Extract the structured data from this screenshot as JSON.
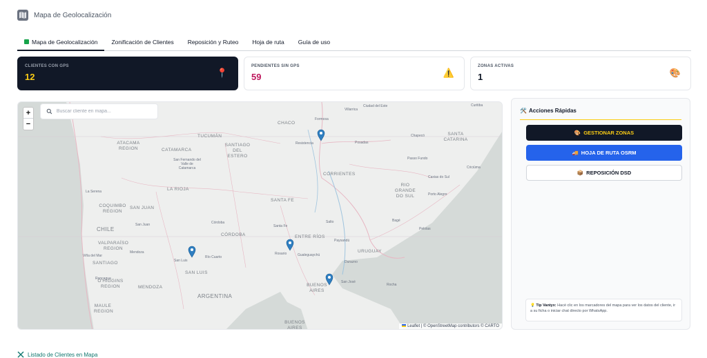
{
  "header": {
    "title": "Mapa de Geolocalización",
    "logo_icon": "map-icon"
  },
  "tabs": [
    {
      "label": "Mapa de Geolocalización",
      "active": true
    },
    {
      "label": "Zonificación de Clientes",
      "active": false
    },
    {
      "label": "Reposición y Ruteo",
      "active": false
    },
    {
      "label": "Hoja de ruta",
      "active": false
    },
    {
      "label": "Guía de uso",
      "active": false
    }
  ],
  "stats": [
    {
      "label": "CLIENTES CON GPS",
      "value": "12",
      "icon": "📍"
    },
    {
      "label": "PENDIENTES SIN GPS",
      "value": "59",
      "icon": "⚠️"
    },
    {
      "label": "ZONAS ACTIVAS",
      "value": "1",
      "icon": "🎨"
    }
  ],
  "map": {
    "zoom_in": "+",
    "zoom_out": "−",
    "search_placeholder": "Buscar cliente en mapa...",
    "attribution": "Leaflet | © OpenStreetMap contributors © CARTO",
    "places": {
      "chaco": "CHACO",
      "tucuman": "TUCUMÁN",
      "atacama": "ATACAMA REGION",
      "catamarca": "CATAMARCA",
      "santiago": "SANTIAGO DEL ESTERO",
      "corrientes": "CORRIENTES",
      "santa_catarina": "SANTA CATARINA",
      "rio_grande": "RIO GRANDE DO SUL",
      "la_rioja": "LA RIOJA",
      "coquimbo": "COQUIMBO REGION",
      "san_juan": "SAN JUAN",
      "santa_fe": "SANTA FE",
      "chile": "CHILE",
      "cordoba": "CÓRDOBA",
      "entre_rios": "ENTRE RÍOS",
      "valparaiso": "VALPARAÍSO REGION",
      "uruguay": "URUGUAY",
      "santiago_cl": "SANTIAGO",
      "san_luis": "SAN LUIS",
      "ohiggins": "O'HIGGINS REGION",
      "mendoza": "MENDOZA",
      "buenos_aires": "BUENOS AIRES",
      "argentina": "ARGENTINA",
      "maule": "MAULE REGION",
      "buenos_aires_s": "BUENOS AIRES"
    },
    "cities": {
      "formosa": "Formosa",
      "villarrica": "Villarrica",
      "ciudad_del_este": "Ciudad del Este",
      "curitiba": "Curitiba",
      "resistencia": "Resistencia",
      "posadas": "Posadas",
      "chapeco": "Chapecó",
      "san_fernando": "San Fernando del Valle de Catamarca",
      "passo_fundo": "Passo Fundo",
      "criciuma": "Criciúma",
      "caxias": "Caxias do Sul",
      "la_serena": "La Serena",
      "porto_alegre": "Porto Alegre",
      "san_juan_c": "San Juan",
      "cordoba_c": "Córdoba",
      "santa_fe_c": "Santa Fe",
      "salto": "Salto",
      "bage": "Bagé",
      "pelotas": "Pelotas",
      "paysandu": "Paysandú",
      "rosario": "Rosario",
      "gualeguaychu": "Gualeguaychú",
      "vina": "Viña del Mar",
      "mendoza_c": "Mendoza",
      "rio_cuarto": "Río Cuarto",
      "san_luis_c": "San Luis",
      "durazno": "Durazno",
      "rancagua": "Rancagua",
      "san_jose": "San José",
      "rocha": "Rocha"
    }
  },
  "side_panel": {
    "title": "Acciones Rápidas",
    "title_icon": "🛠️",
    "actions": [
      {
        "icon": "🎨",
        "label": "GESTIONAR ZONAS"
      },
      {
        "icon": "🚚",
        "label": "HOJA DE RUTA OSRM"
      },
      {
        "icon": "📦",
        "label": "REPOSICIÓN DSD"
      }
    ],
    "tip_icon": "💡",
    "tip_label": "Tip Vantyx:",
    "tip_text": "Hacé clic en los marcadores del mapa para ver los datos del cliente, ir a su ficha o iniciar chat directo por WhatsApp."
  },
  "footer": {
    "title": "Listado de Clientes en Mapa"
  },
  "colors": {
    "primary_dark": "#111827",
    "accent_yellow": "#facc15",
    "accent_blue": "#2563eb",
    "danger": "#be185d",
    "pin": "#2f7fc1"
  }
}
